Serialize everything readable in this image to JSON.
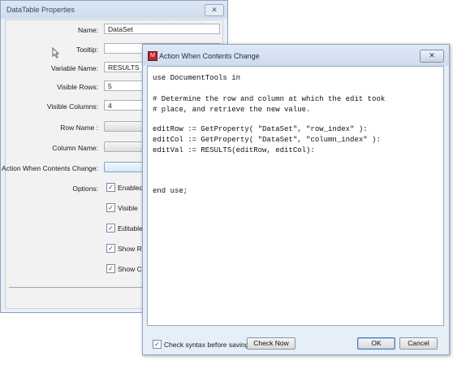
{
  "props_dialog": {
    "title": "DataTable Properties",
    "close_glyph": "✕",
    "name_label": "Name:",
    "name_value": "DataSet",
    "tooltip_label": "Tooltip:",
    "tooltip_value": "",
    "variable_label": "Variable Name:",
    "variable_value": "RESULTS",
    "rows_label": "Visible Rows:",
    "rows_value": "5",
    "cols_label": "Visible Columns:",
    "cols_value": "4",
    "row_name_label": "Row Name :",
    "column_name_label": "Column Name:",
    "action_label": "Action When Contents Change:",
    "options_label": "Options:",
    "options": [
      {
        "label": "Enabled",
        "checked": true
      },
      {
        "label": "Visible",
        "checked": true
      },
      {
        "label": "Editable",
        "checked": true
      },
      {
        "label": "Show Ro",
        "checked": true
      },
      {
        "label": "Show Co",
        "checked": true
      }
    ]
  },
  "action_dialog": {
    "title": "Action When Contents Change",
    "close_glyph": "✕",
    "code_lines": [
      "use DocumentTools in",
      "",
      "# Determine the row and column at which the edit took",
      "# place, and retrieve the new value.",
      "",
      "editRow := GetProperty( \"DataSet\", \"row_index\" ):",
      "editCol := GetProperty( \"DataSet\", \"column_index\" ):",
      "editVal := RESULTS(editRow, editCol):",
      "",
      "",
      "",
      "",
      "",
      "end use;"
    ],
    "check_syntax_label": "Check syntax before saving",
    "check_syntax_checked": true,
    "check_now_label": "Check Now",
    "ok_label": "OK",
    "cancel_label": "Cancel"
  },
  "check_glyph": "✓"
}
